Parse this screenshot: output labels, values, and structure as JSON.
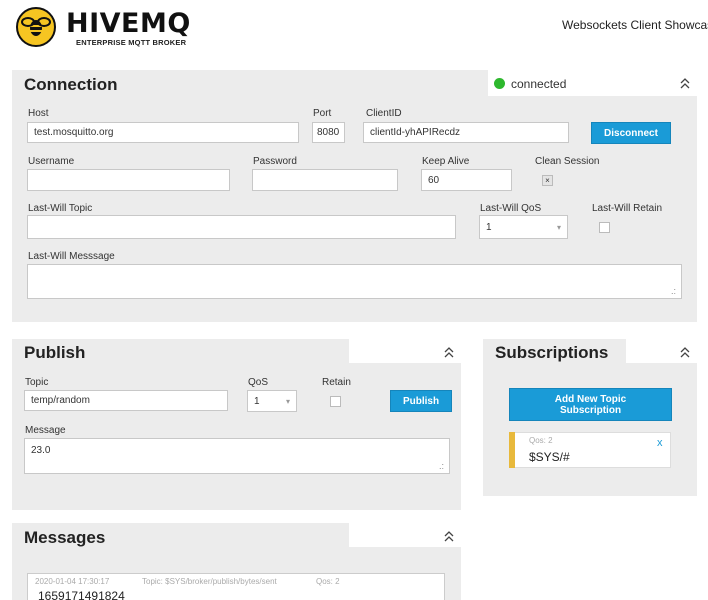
{
  "header": {
    "brand": "HIVEMQ",
    "brand_sub": "ENTERPRISE MQTT BROKER",
    "app_title": "Websockets Client Showcase"
  },
  "connection": {
    "title": "Connection",
    "status": "connected",
    "status_color": "#2eb82e",
    "host_label": "Host",
    "host_value": "test.mosquitto.org",
    "port_label": "Port",
    "port_value": "8080",
    "clientid_label": "ClientID",
    "clientid_value": "clientId-yhAPIRecdz",
    "disconnect_label": "Disconnect",
    "username_label": "Username",
    "username_value": "",
    "password_label": "Password",
    "password_value": "",
    "keepalive_label": "Keep Alive",
    "keepalive_value": "60",
    "clean_session_label": "Clean Session",
    "clean_session_mark": "×",
    "lastwill_topic_label": "Last-Will Topic",
    "lastwill_topic_value": "",
    "lastwill_qos_label": "Last-Will QoS",
    "lastwill_qos_value": "1",
    "lastwill_retain_label": "Last-Will Retain",
    "lastwill_message_label": "Last-Will Messsage",
    "lastwill_message_value": ""
  },
  "publish": {
    "title": "Publish",
    "topic_label": "Topic",
    "topic_value": "temp/random",
    "qos_label": "QoS",
    "qos_value": "1",
    "retain_label": "Retain",
    "publish_label": "Publish",
    "message_label": "Message",
    "message_value": "23.0"
  },
  "subscriptions": {
    "title": "Subscriptions",
    "add_label": "Add New Topic Subscription",
    "items": [
      {
        "qos": "Qos: 2",
        "topic": "$SYS/#",
        "remove": "x",
        "color": "#e8b93c"
      }
    ]
  },
  "messages": {
    "title": "Messages",
    "items": [
      {
        "time": "2020-01-04 17:30:17",
        "topic": "Topic: $SYS/broker/publish/bytes/sent",
        "qos": "Qos: 2",
        "payload": "1659171491824"
      }
    ]
  },
  "icons": {
    "collapse": "∩",
    "select_arrow": "▾",
    "resize": ".:"
  },
  "colors": {
    "accent": "#1a9bd7",
    "panel": "#ececec",
    "brand_yellow": "#f6c522"
  }
}
